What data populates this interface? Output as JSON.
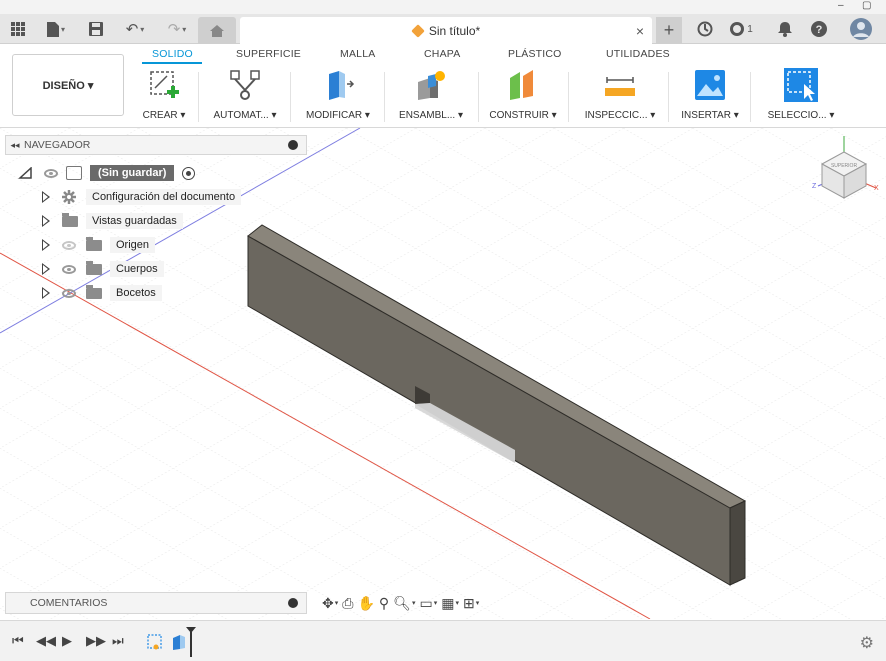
{
  "window": {
    "minimize": "–",
    "restore": "▢"
  },
  "topbar": {
    "doc_title": "Sin título*",
    "close": "×",
    "new_tab": "+",
    "jobs_count": "1"
  },
  "ribbon": {
    "tabs": [
      "SOLIDO",
      "SUPERFICIE",
      "MALLA",
      "CHAPA",
      "PLÁSTICO",
      "UTILIDADES"
    ],
    "active_tab": "SOLIDO",
    "workspace": "DISEÑO ▾",
    "groups": [
      {
        "label": "CREAR ▾",
        "icon": "create-sketch-icon"
      },
      {
        "label": "AUTOMAT... ▾",
        "icon": "automate-icon"
      },
      {
        "label": "MODIFICAR ▾",
        "icon": "modify-icon"
      },
      {
        "label": "ENSAMBL... ▾",
        "icon": "assemble-icon"
      },
      {
        "label": "CONSTRUIR ▾",
        "icon": "construct-icon"
      },
      {
        "label": "INSPECCIC... ▾",
        "icon": "inspect-icon"
      },
      {
        "label": "INSERTAR ▾",
        "icon": "insert-icon"
      },
      {
        "label": "SELECCIO... ▾",
        "icon": "select-icon"
      }
    ]
  },
  "navigator": {
    "title": "NAVEGADOR",
    "root": "(Sin guardar)",
    "items": [
      {
        "label": "Configuración del documento",
        "icon": "gear-icon"
      },
      {
        "label": "Vistas guardadas",
        "icon": "folder-icon"
      },
      {
        "label": "Origen",
        "icon": "folder-icon",
        "visible": false
      },
      {
        "label": "Cuerpos",
        "icon": "folder-icon",
        "visible": true
      },
      {
        "label": "Bocetos",
        "icon": "folder-icon",
        "visible": true
      }
    ]
  },
  "comments": {
    "title": "COMENTARIOS"
  },
  "colors": {
    "accent": "#0696d7",
    "body_face": "#6b675f",
    "body_top": "#8a857b",
    "body_side": "#4a4741"
  }
}
